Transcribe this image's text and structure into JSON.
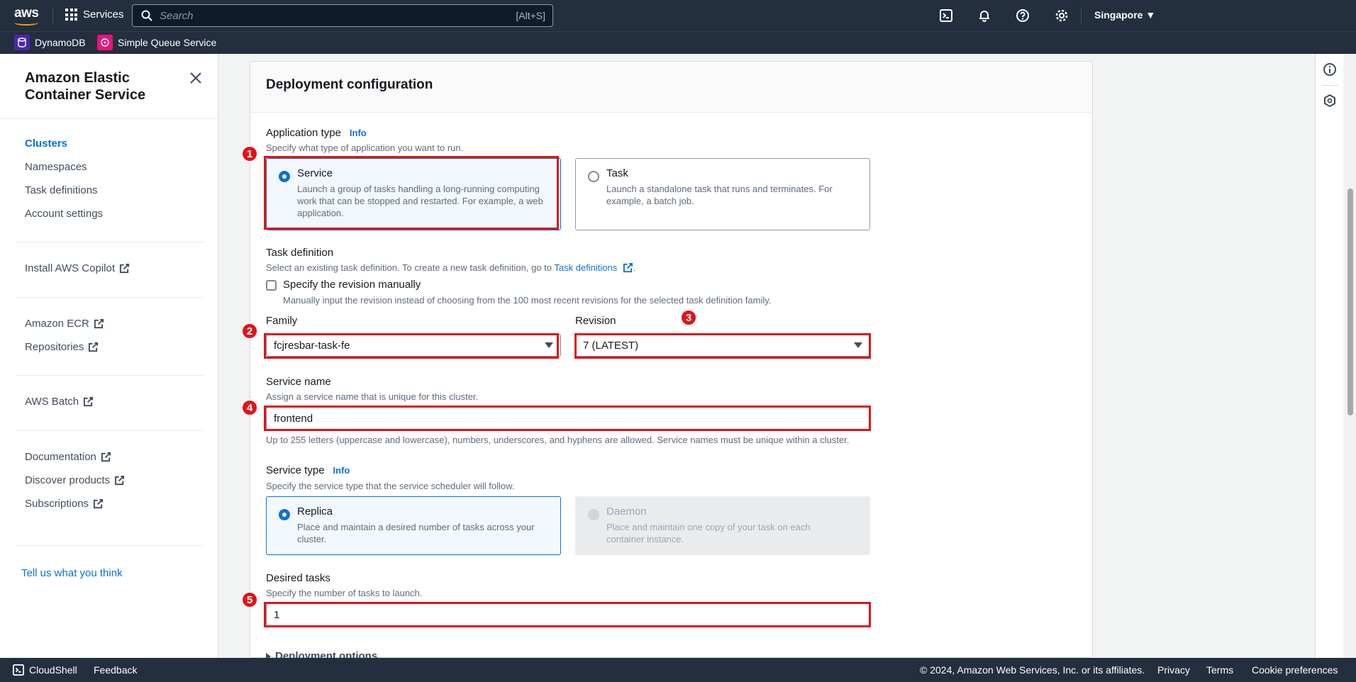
{
  "topnav": {
    "logo": "aws",
    "services_label": "Services",
    "search_placeholder": "Search",
    "search_shortcut": "[Alt+S]",
    "region": "Singapore ▼",
    "icons": [
      "cloudshell-icon",
      "bell-icon",
      "help-icon",
      "gear-icon"
    ]
  },
  "favorites": [
    {
      "label": "DynamoDB",
      "color": "#4d27aa"
    },
    {
      "label": "Simple Queue Service",
      "color": "#e7157b"
    }
  ],
  "sidebar": {
    "title": "Amazon Elastic Container Service",
    "groups": [
      [
        "Clusters",
        "Namespaces",
        "Task definitions",
        "Account settings"
      ],
      [
        "Install AWS Copilot"
      ],
      [
        "Amazon ECR",
        "Repositories"
      ],
      [
        "AWS Batch"
      ],
      [
        "Documentation",
        "Discover products",
        "Subscriptions"
      ]
    ],
    "items": {
      "clusters": "Clusters",
      "namespaces": "Namespaces",
      "task_definitions": "Task definitions",
      "account_settings": "Account settings",
      "install_copilot": "Install AWS Copilot",
      "amazon_ecr": "Amazon ECR",
      "repositories": "Repositories",
      "aws_batch": "AWS Batch",
      "documentation": "Documentation",
      "discover_products": "Discover products",
      "subscriptions": "Subscriptions"
    },
    "feedback": "Tell us what you think"
  },
  "form": {
    "section_title": "Deployment configuration",
    "app_type": {
      "label": "Application type",
      "info": "Info",
      "desc": "Specify what type of application you want to run.",
      "options": {
        "service": {
          "title": "Service",
          "desc": "Launch a group of tasks handling a long-running computing work that can be stopped and restarted. For example, a web application.",
          "selected": true
        },
        "task": {
          "title": "Task",
          "desc": "Launch a standalone task that runs and terminates. For example, a batch job.",
          "selected": false
        }
      }
    },
    "task_definition": {
      "label": "Task definition",
      "desc_prefix": "Select an existing task definition. To create a new task definition, go to ",
      "desc_link": "Task definitions",
      "desc_suffix": ".",
      "manual_label": "Specify the revision manually",
      "manual_desc": "Manually input the revision instead of choosing from the 100 most recent revisions for the selected task definition family.",
      "manual_checked": false
    },
    "family": {
      "label": "Family",
      "value": "fcjresbar-task-fe"
    },
    "revision": {
      "label": "Revision",
      "value": "7 (LATEST)"
    },
    "service_name": {
      "label": "Service name",
      "desc": "Assign a service name that is unique for this cluster.",
      "value": "frontend",
      "constraint": "Up to 255 letters (uppercase and lowercase), numbers, underscores, and hyphens are allowed. Service names must be unique within a cluster."
    },
    "service_type": {
      "label": "Service type",
      "info": "Info",
      "desc": "Specify the service type that the service scheduler will follow.",
      "options": {
        "replica": {
          "title": "Replica",
          "desc": "Place and maintain a desired number of tasks across your cluster.",
          "selected": true
        },
        "daemon": {
          "title": "Daemon",
          "desc": "Place and maintain one copy of your task on each container instance.",
          "selected": false,
          "disabled": true
        }
      }
    },
    "desired_tasks": {
      "label": "Desired tasks",
      "desc": "Specify the number of tasks to launch.",
      "value": "1"
    },
    "deployment_options": "Deployment options"
  },
  "annotations": [
    "1",
    "2",
    "3",
    "4",
    "5"
  ],
  "footer": {
    "cloudshell": "CloudShell",
    "feedback": "Feedback",
    "copyright": "© 2024, Amazon Web Services, Inc. or its affiliates.",
    "privacy": "Privacy",
    "terms": "Terms",
    "cookie": "Cookie preferences"
  },
  "colors": {
    "nav_bg": "#232f3e",
    "link": "#0972d3",
    "highlight": "#e0131a",
    "accent": "#ff9900"
  }
}
